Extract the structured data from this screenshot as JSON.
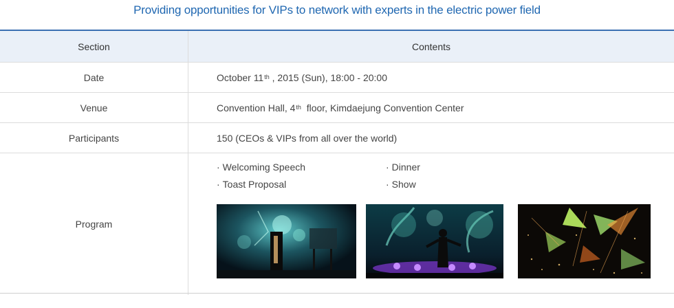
{
  "title": "Providing opportunities for VIPs to network with experts in the electric power field",
  "table": {
    "header": {
      "section": "Section",
      "contents": "Contents"
    },
    "date": {
      "label": "Date",
      "pre": "October 11",
      "sup": "th",
      "post": " , 2015 (Sun), 18:00 - 20:00"
    },
    "venue": {
      "label": "Venue",
      "pre": "Convention Hall, 4",
      "sup": "th",
      "post": "  floor, Kimdaejung Convention Center"
    },
    "participants": {
      "label": "Participants",
      "value": "150 (CEOs & VIPs from all over the world)"
    },
    "program": {
      "label": "Program",
      "bullet": "·",
      "items": [
        "Welcoming Speech",
        "Toast Proposal",
        "Dinner",
        "Show"
      ]
    }
  },
  "colors": {
    "accent": "#1f67b1",
    "header_bg": "#eaf0f8",
    "border": "#dcdcdc"
  }
}
